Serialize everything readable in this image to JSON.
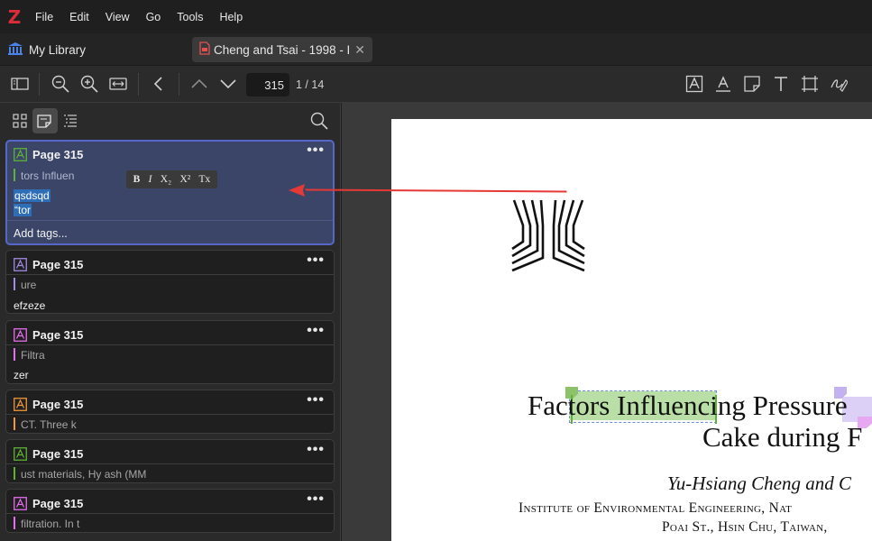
{
  "menu": {
    "items": [
      "File",
      "Edit",
      "View",
      "Go",
      "Tools",
      "Help"
    ]
  },
  "tabs": {
    "library_label": "My Library",
    "document_title": "Cheng and Tsai - 1998 - F",
    "close_glyph": "✕"
  },
  "toolbar": {
    "page_value": "315",
    "page_count": "1 / 14"
  },
  "format_bar": {
    "bold": "B",
    "italic": "I",
    "subscript": "X₂",
    "superscript": "X²",
    "clear": "Tx"
  },
  "annotations": [
    {
      "page_label": "Page 315",
      "color": "#5fb236",
      "highlight": "tors Influen",
      "comment_line1": "qsdsqd",
      "comment_line2": "“tor",
      "tags_placeholder": "Add tags...",
      "selected": true
    },
    {
      "page_label": "Page 315",
      "color": "#a28ae5",
      "highlight": "ure",
      "comment": "efzeze"
    },
    {
      "page_label": "Page 315",
      "color": "#e56eee",
      "highlight": "Filtra",
      "comment": "zer"
    },
    {
      "page_label": "Page 315",
      "color": "#f19837",
      "highlight": "CT. Three k"
    },
    {
      "page_label": "Page 315",
      "color": "#5fb236",
      "highlight": "ust materials, Hy ash (MM"
    },
    {
      "page_label": "Page 315",
      "color": "#e56eee",
      "highlight": "filtration. In t"
    }
  ],
  "more_glyph": "•••",
  "pdf": {
    "title_line1": "Factors Influencing Pressure",
    "title_line2": "Cake during F",
    "authors": "Yu-Hsiang Cheng and C",
    "affiliation_line1": "Institute of Environmental Engineering, Nat",
    "affiliation_line2": "Poai St., Hsin Chu, Taiwan,"
  },
  "colors": {
    "accent_selected_border": "#5667c8",
    "arrow": "#e53935",
    "logo": "#db2c3a"
  }
}
